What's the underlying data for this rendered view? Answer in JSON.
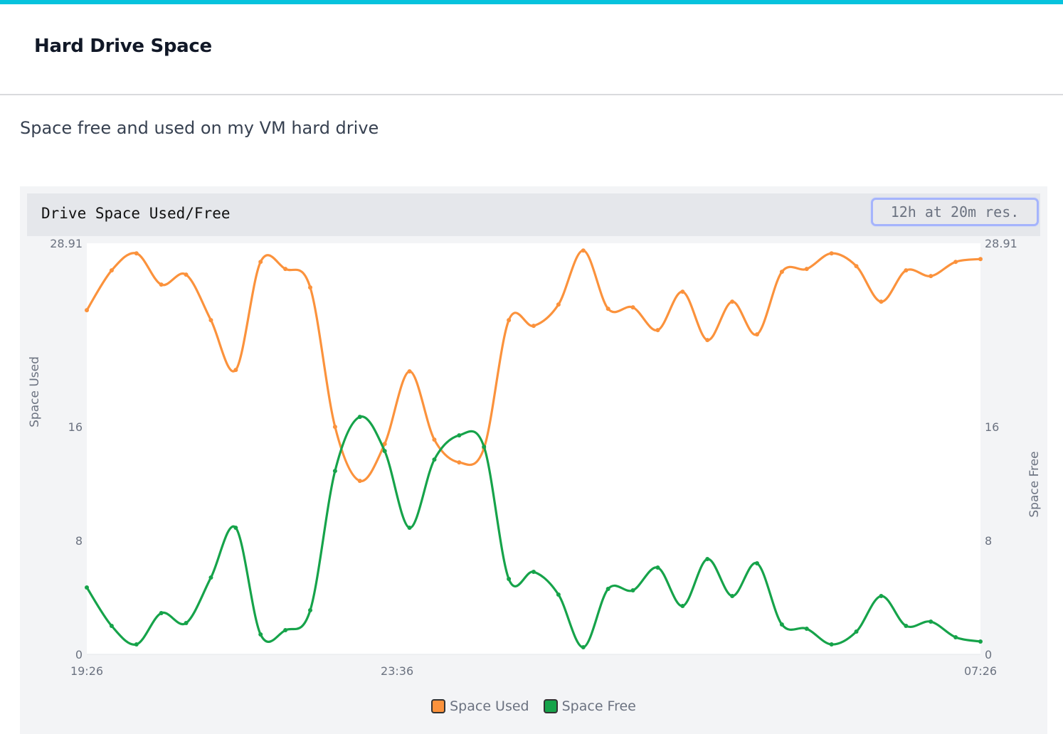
{
  "page": {
    "title": "Hard Drive Space",
    "description": "Space free and used on my VM hard drive"
  },
  "panel": {
    "title": "Drive Space Used/Free",
    "range_label": "12h at 20m res."
  },
  "colors": {
    "accent": "#06c3dd",
    "space_used": "#fb923c",
    "space_free": "#16a34a"
  },
  "chart_data": {
    "type": "line",
    "x_tick_labels": [
      "19:26",
      "23:36",
      "07:26"
    ],
    "x_ticks": [
      0,
      12.5,
      36
    ],
    "x_range": [
      0,
      36
    ],
    "y_left": {
      "label": "Space Used",
      "range": [
        0,
        28.91
      ],
      "ticks": [
        0,
        8,
        16,
        28.91
      ],
      "tick_labels": [
        "0",
        "8",
        "16",
        "28.91"
      ]
    },
    "y_right": {
      "label": "Space Free",
      "range": [
        0,
        28.91
      ],
      "ticks": [
        0,
        8,
        16,
        28.91
      ],
      "tick_labels": [
        "0",
        "8",
        "16",
        "28.91"
      ]
    },
    "x": [
      0,
      1,
      2,
      3,
      4,
      5,
      6,
      7,
      8,
      9,
      10,
      11,
      12,
      13,
      14,
      15,
      16,
      17,
      18,
      19,
      20,
      21,
      22,
      23,
      24,
      25,
      26,
      27,
      28,
      29,
      30,
      31,
      32,
      33,
      34,
      35,
      36
    ],
    "series": [
      {
        "name": "Space Used",
        "axis": "left",
        "values": [
          24.2,
          27.0,
          28.2,
          26.0,
          26.7,
          23.5,
          20.0,
          27.6,
          27.1,
          25.8,
          16.0,
          12.2,
          14.8,
          19.9,
          15.1,
          13.5,
          14.5,
          23.5,
          23.1,
          24.6,
          28.4,
          24.3,
          24.4,
          22.8,
          25.5,
          22.1,
          24.8,
          22.5,
          26.9,
          27.1,
          28.2,
          27.3,
          24.8,
          27.0,
          26.6,
          27.6,
          27.8
        ]
      },
      {
        "name": "Space Free",
        "axis": "right",
        "values": [
          4.7,
          2.0,
          0.7,
          2.9,
          2.2,
          5.4,
          8.9,
          1.4,
          1.7,
          3.1,
          12.9,
          16.7,
          14.3,
          8.9,
          13.7,
          15.4,
          14.6,
          5.3,
          5.8,
          4.2,
          0.5,
          4.6,
          4.5,
          6.1,
          3.4,
          6.7,
          4.1,
          6.4,
          2.1,
          1.8,
          0.7,
          1.6,
          4.1,
          2.0,
          2.3,
          1.2,
          0.9
        ]
      }
    ],
    "legend": {
      "placement": "bottom-center",
      "entries": [
        "Space Used",
        "Space Free"
      ]
    },
    "grid": false
  }
}
